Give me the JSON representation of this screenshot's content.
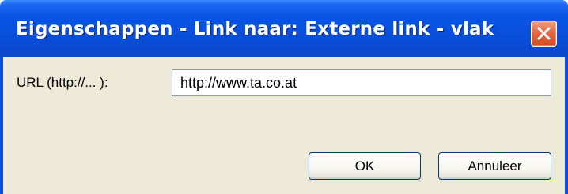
{
  "window": {
    "title": "Eigenschappen - Link naar: Externe link - vlak",
    "close_icon": "close-icon",
    "accent_color": "#0a4fd6",
    "close_color": "#d14b22"
  },
  "form": {
    "url_label": "URL (http://... ):",
    "url_value": "http://www.ta.co.at"
  },
  "buttons": {
    "ok_label": "OK",
    "cancel_label": "Annuleer"
  }
}
